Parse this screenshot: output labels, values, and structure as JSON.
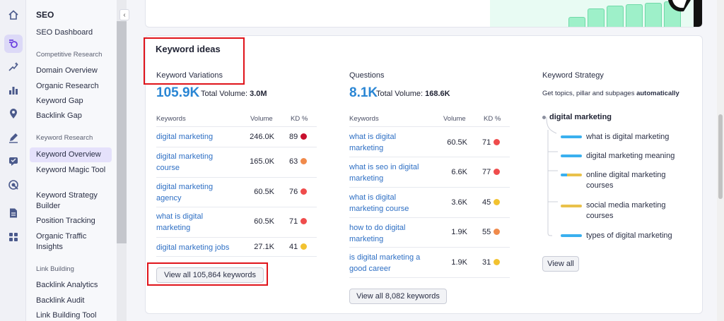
{
  "sidebar": {
    "header": "SEO",
    "items": [
      {
        "label": "SEO Dashboard"
      },
      {
        "section": "Competitive Research"
      },
      {
        "label": "Domain Overview"
      },
      {
        "label": "Organic Research"
      },
      {
        "label": "Keyword Gap"
      },
      {
        "label": "Backlink Gap"
      },
      {
        "section": "Keyword Research"
      },
      {
        "label": "Keyword Overview",
        "active": true
      },
      {
        "label": "Keyword Magic Tool"
      },
      {
        "label": "Keyword Strategy Builder"
      },
      {
        "label": "Position Tracking"
      },
      {
        "label": "Organic Traffic Insights"
      },
      {
        "section": "Link Building"
      },
      {
        "label": "Backlink Analytics"
      },
      {
        "label": "Backlink Audit"
      },
      {
        "label": "Link Building Tool"
      }
    ],
    "collapse_icon": "‹"
  },
  "rail_icons": [
    "home-icon",
    "seo-icon",
    "ai-sparkle-icon",
    "bar-chart-icon",
    "location-pin-icon",
    "pen-icon",
    "chat-icon",
    "target-icon",
    "document-icon",
    "grid-icon"
  ],
  "card": {
    "title": "Keyword ideas",
    "variations": {
      "title": "Keyword Variations",
      "count": "105.9K",
      "total_label": "Total Volume:",
      "total_value": "3.0M",
      "headers": [
        "Keywords",
        "Volume",
        "KD %"
      ],
      "rows": [
        {
          "keyword": "digital marketing",
          "volume": "246.0K",
          "kd": "89",
          "color": "#c8102e"
        },
        {
          "keyword": "digital marketing course",
          "volume": "165.0K",
          "kd": "63",
          "color": "#f08a4b"
        },
        {
          "keyword": "digital marketing agency",
          "volume": "60.5K",
          "kd": "76",
          "color": "#ef4c4c"
        },
        {
          "keyword": "what is digital marketing",
          "volume": "60.5K",
          "kd": "71",
          "color": "#ef4c4c"
        },
        {
          "keyword": "digital marketing jobs",
          "volume": "27.1K",
          "kd": "41",
          "color": "#f2c230"
        }
      ],
      "view_all": "View all 105,864 keywords"
    },
    "questions": {
      "title": "Questions",
      "count": "8.1K",
      "total_label": "Total Volume:",
      "total_value": "168.6K",
      "headers": [
        "Keywords",
        "Volume",
        "KD %"
      ],
      "rows": [
        {
          "keyword": "what is digital marketing",
          "volume": "60.5K",
          "kd": "71",
          "color": "#ef4c4c"
        },
        {
          "keyword": "what is seo in digital marketing",
          "volume": "6.6K",
          "kd": "77",
          "color": "#ef4c4c"
        },
        {
          "keyword": "what is digital marketing course",
          "volume": "3.6K",
          "kd": "45",
          "color": "#f2c230"
        },
        {
          "keyword": "how to do digital marketing",
          "volume": "1.9K",
          "kd": "55",
          "color": "#f08a4b"
        },
        {
          "keyword": "is digital marketing a good career",
          "volume": "1.9K",
          "kd": "31",
          "color": "#f2c230"
        }
      ],
      "view_all": "View all 8,082 keywords"
    },
    "strategy": {
      "title": "Keyword Strategy",
      "subtitle_prefix": "Get topics, pillar and subpages",
      "subtitle_bold": "automatically",
      "root": "digital marketing",
      "leaves": [
        {
          "label": "what is digital marketing"
        },
        {
          "label": "digital marketing meaning"
        },
        {
          "label": "online digital marketing courses"
        },
        {
          "label": "social media marketing courses"
        },
        {
          "label": "types of digital marketing"
        }
      ],
      "view_all": "View all"
    }
  },
  "colors": {
    "accent_blue": "#2a86d4",
    "link": "#2e6fc4",
    "annotation_red": "#e0141b",
    "brand_purple": "#6b3fe0"
  }
}
